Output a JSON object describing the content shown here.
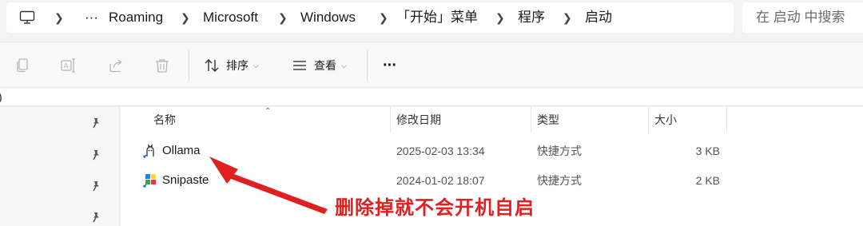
{
  "address_bar": {
    "more": "···",
    "crumbs": [
      "Roaming",
      "Microsoft",
      "Windows",
      "「开始」菜单",
      "程序",
      "启动"
    ]
  },
  "search": {
    "placeholder": "在 启动 中搜索"
  },
  "toolbar": {
    "sort_label": "排序",
    "view_label": "查看",
    "more": "···"
  },
  "path_row": {
    "text": ")"
  },
  "columns": {
    "name": "名称",
    "modified": "修改日期",
    "type": "类型",
    "size": "大小"
  },
  "files": [
    {
      "name": "Ollama",
      "modified": "2025-02-03 13:34",
      "type": "快捷方式",
      "size": "3 KB",
      "icon": "ollama-icon"
    },
    {
      "name": "Snipaste",
      "modified": "2024-01-02 18:07",
      "type": "快捷方式",
      "size": "2 KB",
      "icon": "snipaste-icon"
    }
  ],
  "annotation": {
    "text": "删除掉就不会开机自启",
    "color": "#e02020"
  }
}
